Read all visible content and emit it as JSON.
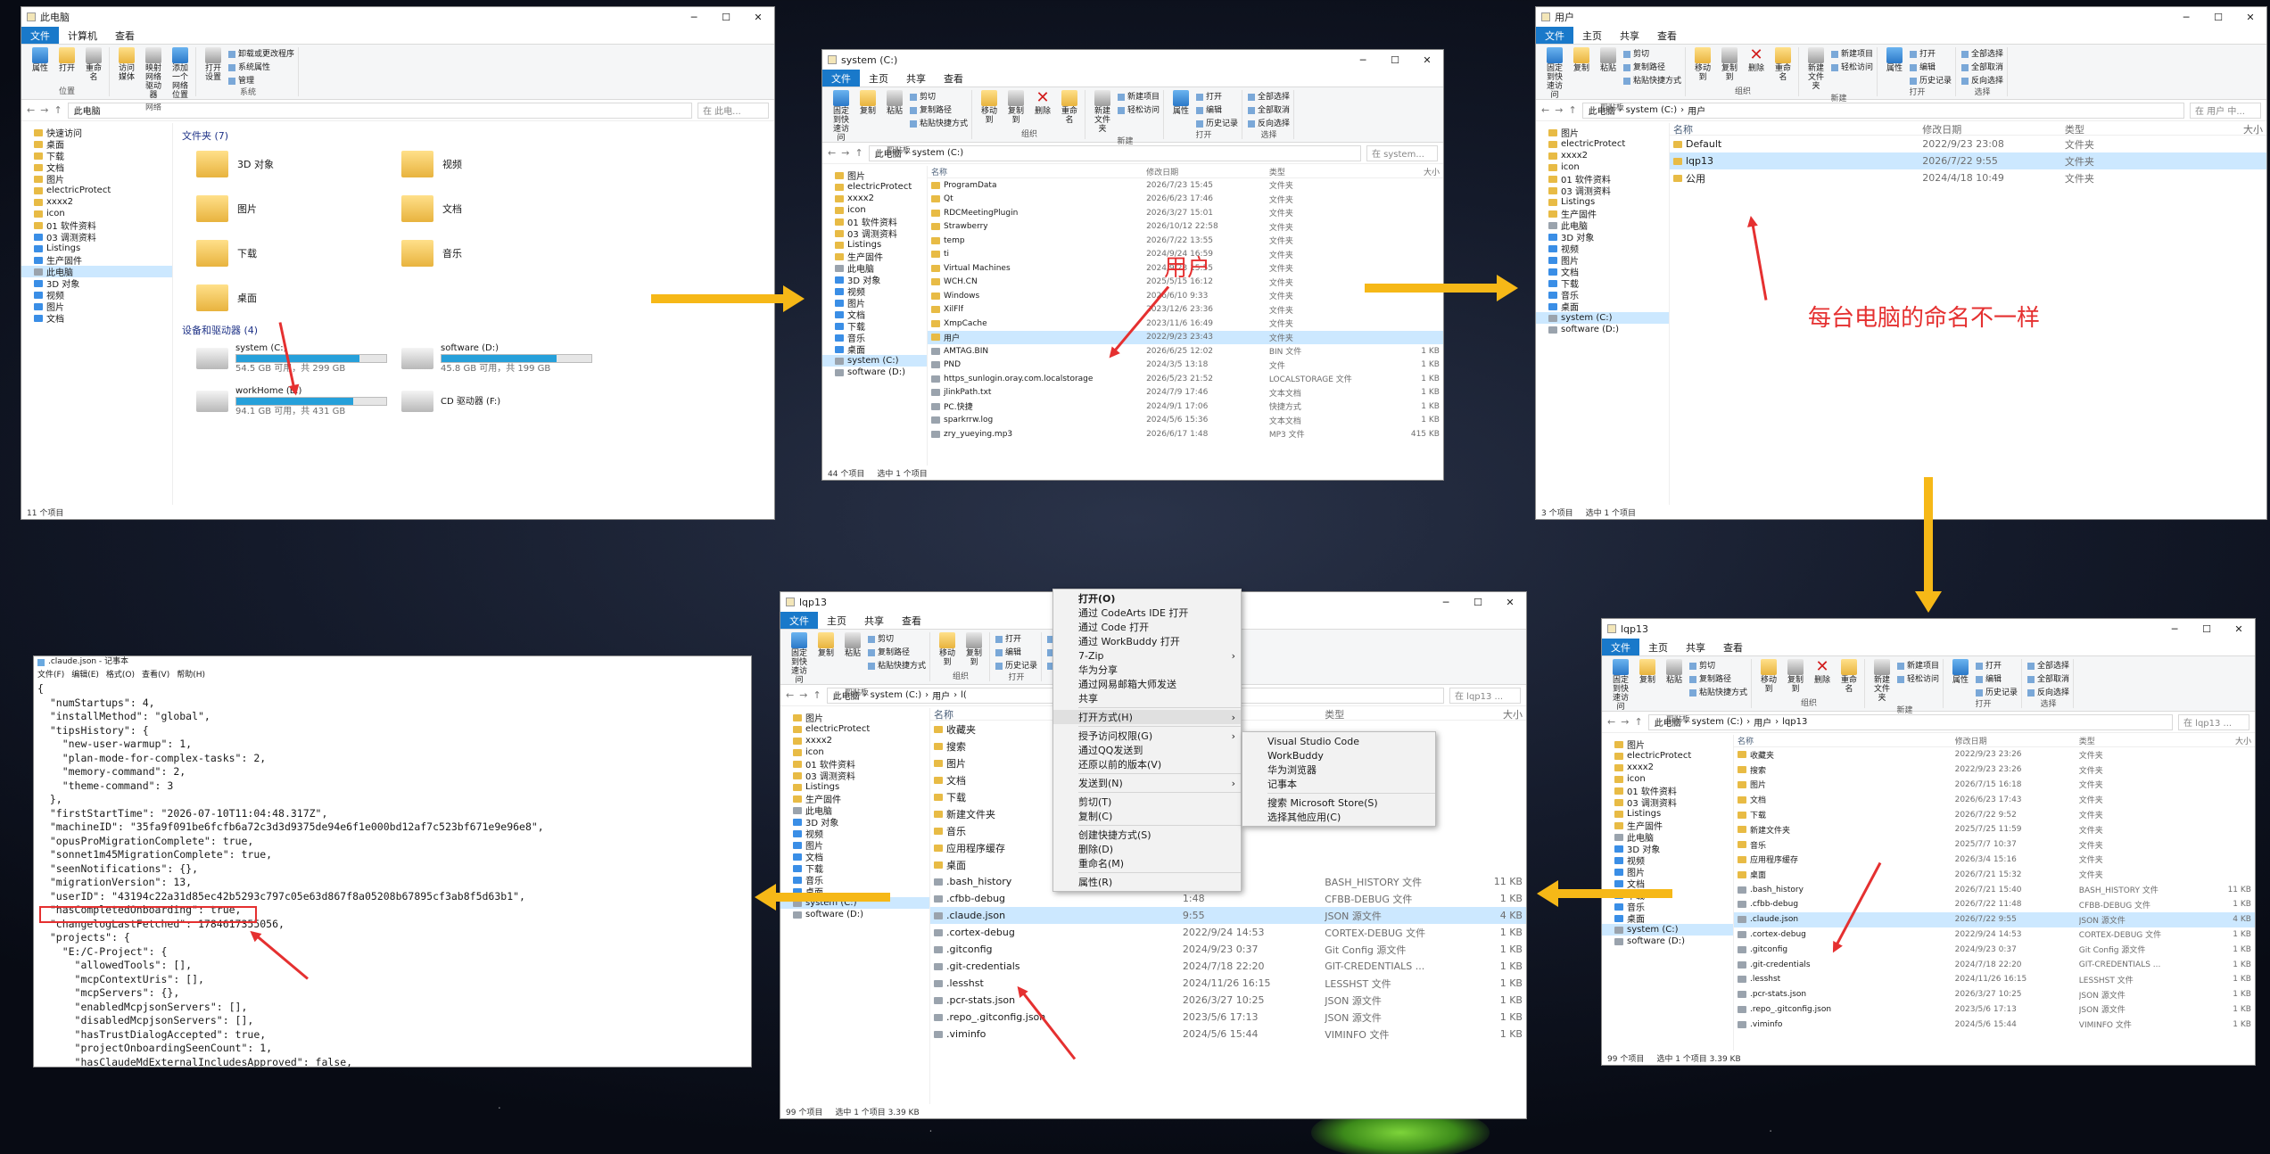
{
  "win1": {
    "title": "此电脑",
    "tabs": [
      "文件",
      "计算机",
      "查看"
    ],
    "ribbon": {
      "groups": [
        {
          "label": "位置",
          "buttons": [
            "属性",
            "打开",
            "重命名"
          ]
        },
        {
          "label": "网络",
          "buttons": [
            "访问媒体",
            "映射网络驱动器",
            "添加一个网络位置"
          ]
        },
        {
          "label": "系统",
          "buttons": [
            "打开设置"
          ],
          "small": [
            "卸载或更改程序",
            "系统属性",
            "管理"
          ]
        }
      ]
    },
    "path": "此电脑",
    "search": "在 此电...",
    "nav": [
      {
        "label": "快速访问"
      },
      {
        "label": "桌面"
      },
      {
        "label": "下载"
      },
      {
        "label": "文档"
      },
      {
        "label": "图片"
      },
      {
        "label": "electricProtect"
      },
      {
        "label": "xxxx2"
      },
      {
        "label": "icon"
      },
      {
        "label": "01 软件资料"
      },
      {
        "label": "03 调测资料"
      },
      {
        "label": "Listings"
      },
      {
        "label": "生产固件"
      },
      {
        "label": "此电脑",
        "sel": true
      },
      {
        "label": "3D 对象"
      },
      {
        "label": "视频"
      },
      {
        "label": "图片"
      },
      {
        "label": "文档"
      }
    ],
    "folders_header": "文件夹 (7)",
    "folders": [
      "3D 对象",
      "视频",
      "图片",
      "文档",
      "下载",
      "音乐",
      "桌面"
    ],
    "drives_header": "设备和驱动器 (4)",
    "drives": [
      {
        "name": "system (C:)",
        "free": "54.5 GB 可用，共 299 GB",
        "fill": 0.82
      },
      {
        "name": "software (D:)",
        "free": "45.8 GB 可用，共 199 GB",
        "fill": 0.77
      },
      {
        "name": "workHome (E:)",
        "free": "94.1 GB 可用，共 431 GB",
        "fill": 0.78
      },
      {
        "name": "CD 驱动器 (F:)",
        "free": "",
        "fill": 0
      }
    ],
    "status": "11 个项目"
  },
  "win2": {
    "title": "system (C:)",
    "tabs": [
      "文件",
      "主页",
      "共享",
      "查看"
    ],
    "ribbon": {
      "groups": [
        {
          "label": "剪贴板",
          "buttons": [
            "固定到快速访问",
            "复制",
            "粘贴"
          ],
          "small": [
            "剪切",
            "复制路径",
            "粘贴快捷方式"
          ]
        },
        {
          "label": "组织",
          "buttons": [
            "移动到",
            "复制到",
            "删除",
            "重命名"
          ]
        },
        {
          "label": "新建",
          "buttons": [
            "新建文件夹"
          ],
          "small": [
            "新建项目",
            "轻松访问"
          ]
        },
        {
          "label": "打开",
          "buttons": [
            "属性"
          ],
          "small": [
            "打开",
            "编辑",
            "历史记录"
          ]
        },
        {
          "label": "选择",
          "small": [
            "全部选择",
            "全部取消",
            "反向选择"
          ]
        }
      ]
    },
    "path": [
      "此电脑",
      "system (C:)"
    ],
    "search": "在 system...",
    "nav": [
      {
        "label": "图片"
      },
      {
        "label": "electricProtect"
      },
      {
        "label": "xxxx2"
      },
      {
        "label": "icon"
      },
      {
        "label": "01 软件资料"
      },
      {
        "label": "03 调测资料"
      },
      {
        "label": "Listings"
      },
      {
        "label": "生产固件"
      },
      {
        "label": "此电脑"
      },
      {
        "label": "3D 对象"
      },
      {
        "label": "视频"
      },
      {
        "label": "图片"
      },
      {
        "label": "文档"
      },
      {
        "label": "下载"
      },
      {
        "label": "音乐"
      },
      {
        "label": "桌面"
      },
      {
        "label": "system (C:)",
        "sel": true
      },
      {
        "label": "software (D:)"
      }
    ],
    "cols": [
      "名称",
      "修改日期",
      "类型",
      "大小"
    ],
    "files": [
      [
        "ProgramData",
        "2026/7/23 15:45",
        "文件夹",
        ""
      ],
      [
        "Qt",
        "2026/6/23 17:46",
        "文件夹",
        ""
      ],
      [
        "RDCMeetingPlugin",
        "2026/3/27 15:01",
        "文件夹",
        ""
      ],
      [
        "Strawberry",
        "2026/10/12 22:58",
        "文件夹",
        ""
      ],
      [
        "temp",
        "2026/7/22 13:55",
        "文件夹",
        ""
      ],
      [
        "ti",
        "2024/9/24 16:59",
        "文件夹",
        ""
      ],
      [
        "Virtual Machines",
        "2024/9/23 15:55",
        "文件夹",
        ""
      ],
      [
        "WCH.CN",
        "2025/5/15 16:12",
        "文件夹",
        ""
      ],
      [
        "Windows",
        "2026/6/10 9:33",
        "文件夹",
        ""
      ],
      [
        "XilFlf",
        "2023/12/6 23:36",
        "文件夹",
        ""
      ],
      [
        "XmpCache",
        "2023/11/6 16:49",
        "文件夹",
        ""
      ],
      [
        "用户",
        "2022/9/23 23:43",
        "文件夹",
        "",
        true
      ],
      [
        "AMTAG.BIN",
        "2026/6/25 12:02",
        "BIN 文件",
        "1 KB"
      ],
      [
        "PND",
        "2024/3/5 13:18",
        "文件",
        "1 KB"
      ],
      [
        "https_sunlogin.oray.com.localstorage",
        "2026/5/23 21:52",
        "LOCALSTORAGE 文件",
        "1 KB"
      ],
      [
        "jlinkPath.txt",
        "2024/7/9 17:46",
        "文本文档",
        "1 KB"
      ],
      [
        "PC.快捷",
        "2024/9/1 17:06",
        "快捷方式",
        "1 KB"
      ],
      [
        "sparkrrw.log",
        "2024/5/6 15:36",
        "文本文档",
        "1 KB"
      ],
      [
        "zry_yueying.mp3",
        "2026/6/17 1:48",
        "MP3 文件",
        "415 KB"
      ]
    ],
    "status": [
      "44 个项目",
      "选中 1 个项目"
    ]
  },
  "win3": {
    "title": "用户",
    "tabs": [
      "文件",
      "主页",
      "共享",
      "查看"
    ],
    "ribbon": {
      "groups": [
        {
          "label": "剪贴板",
          "buttons": [
            "固定到快速访问",
            "复制",
            "粘贴"
          ],
          "small": [
            "剪切",
            "复制路径",
            "粘贴快捷方式"
          ]
        },
        {
          "label": "组织",
          "buttons": [
            "移动到",
            "复制到",
            "删除",
            "重命名"
          ]
        },
        {
          "label": "新建",
          "buttons": [
            "新建文件夹"
          ],
          "small": [
            "新建项目",
            "轻松访问"
          ]
        },
        {
          "label": "打开",
          "buttons": [
            "属性"
          ],
          "small": [
            "打开",
            "编辑",
            "历史记录"
          ]
        },
        {
          "label": "选择",
          "small": [
            "全部选择",
            "全部取消",
            "反向选择"
          ]
        }
      ]
    },
    "path": [
      "此电脑",
      "system (C:)",
      "用户"
    ],
    "search": "在 用户 中...",
    "nav": [
      {
        "label": "图片"
      },
      {
        "label": "electricProtect"
      },
      {
        "label": "xxxx2"
      },
      {
        "label": "icon"
      },
      {
        "label": "01 软件资料"
      },
      {
        "label": "03 调测资料"
      },
      {
        "label": "Listings"
      },
      {
        "label": "生产固件"
      },
      {
        "label": "此电脑"
      },
      {
        "label": "3D 对象"
      },
      {
        "label": "视频"
      },
      {
        "label": "图片"
      },
      {
        "label": "文档"
      },
      {
        "label": "下载"
      },
      {
        "label": "音乐"
      },
      {
        "label": "桌面"
      },
      {
        "label": "system (C:)",
        "sel": true
      },
      {
        "label": "software (D:)"
      }
    ],
    "cols": [
      "名称",
      "修改日期",
      "类型",
      "大小"
    ],
    "files": [
      [
        "Default",
        "2022/9/23 23:08",
        "文件夹",
        ""
      ],
      [
        "lqp13",
        "2026/7/22 9:55",
        "文件夹",
        "",
        true
      ],
      [
        "公用",
        "2024/4/18 10:49",
        "文件夹",
        ""
      ]
    ],
    "status": [
      "3 个项目",
      "选中 1 个项目"
    ]
  },
  "win4": {
    "title": "lqp13",
    "tabs": [
      "文件",
      "主页",
      "共享",
      "查看"
    ],
    "ribbon": {
      "groups": [
        {
          "label": "剪贴板",
          "buttons": [
            "固定到快速访问",
            "复制",
            "粘贴"
          ],
          "small": [
            "剪切",
            "复制路径",
            "粘贴快捷方式"
          ]
        },
        {
          "label": "组织",
          "buttons": [
            "移动到",
            "复制到",
            "删除",
            "重命名"
          ]
        },
        {
          "label": "新建",
          "buttons": [
            "新建文件夹"
          ],
          "small": [
            "新建项目",
            "轻松访问"
          ]
        },
        {
          "label": "打开",
          "buttons": [
            "属性"
          ],
          "small": [
            "打开",
            "编辑",
            "历史记录"
          ]
        },
        {
          "label": "选择",
          "small": [
            "全部选择",
            "全部取消",
            "反向选择"
          ]
        }
      ]
    },
    "path": [
      "此电脑",
      "system (C:)",
      "用户",
      "lqp13"
    ],
    "search": "在 lqp13 ...",
    "nav": [
      {
        "label": "图片"
      },
      {
        "label": "electricProtect"
      },
      {
        "label": "xxxx2"
      },
      {
        "label": "icon"
      },
      {
        "label": "01 软件资料"
      },
      {
        "label": "03 调测资料"
      },
      {
        "label": "Listings"
      },
      {
        "label": "生产固件"
      },
      {
        "label": "此电脑"
      },
      {
        "label": "3D 对象"
      },
      {
        "label": "视频"
      },
      {
        "label": "图片"
      },
      {
        "label": "文档"
      },
      {
        "label": "下载"
      },
      {
        "label": "音乐"
      },
      {
        "label": "桌面"
      },
      {
        "label": "system (C:)",
        "sel": true
      },
      {
        "label": "software (D:)"
      }
    ],
    "cols": [
      "名称",
      "修改日期",
      "类型",
      "大小"
    ],
    "files": [
      [
        "收藏夹",
        "2022/9/23 23:26",
        "文件夹",
        ""
      ],
      [
        "搜索",
        "2022/9/23 23:26",
        "文件夹",
        ""
      ],
      [
        "图片",
        "2026/7/15 16:18",
        "文件夹",
        ""
      ],
      [
        "文档",
        "2026/6/23 17:43",
        "文件夹",
        ""
      ],
      [
        "下载",
        "2026/7/22 9:52",
        "文件夹",
        ""
      ],
      [
        "新建文件夹",
        "2025/7/25 11:59",
        "文件夹",
        ""
      ],
      [
        "音乐",
        "2025/7/7 10:37",
        "文件夹",
        ""
      ],
      [
        "应用程序缓存",
        "2026/3/4 15:16",
        "文件夹",
        ""
      ],
      [
        "桌面",
        "2026/7/21 15:32",
        "文件夹",
        ""
      ],
      [
        ".bash_history",
        "2026/7/21 15:40",
        "BASH_HISTORY 文件",
        "11 KB"
      ],
      [
        ".cfbb-debug",
        "2026/7/22 11:48",
        "CFBB-DEBUG 文件",
        "1 KB"
      ],
      [
        ".claude.json",
        "2026/7/22 9:55",
        "JSON 源文件",
        "4 KB",
        true
      ],
      [
        ".cortex-debug",
        "2022/9/24 14:53",
        "CORTEX-DEBUG 文件",
        "1 KB"
      ],
      [
        ".gitconfig",
        "2024/9/23 0:37",
        "Git Config 源文件",
        "1 KB"
      ],
      [
        ".git-credentials",
        "2024/7/18 22:20",
        "GIT-CREDENTIALS ...",
        "1 KB"
      ],
      [
        ".lesshst",
        "2024/11/26 16:15",
        "LESSHST 文件",
        "1 KB"
      ],
      [
        ".pcr-stats.json",
        "2026/3/27 10:25",
        "JSON 源文件",
        "1 KB"
      ],
      [
        ".repo_.gitconfig.json",
        "2023/5/6 17:13",
        "JSON 源文件",
        "1 KB"
      ],
      [
        ".viminfo",
        "2024/5/6 15:44",
        "VIMINFO 文件",
        "1 KB"
      ]
    ],
    "status": [
      "99 个项目",
      "选中 1 个项目 3.39 KB"
    ]
  },
  "win5": {
    "title": "lqp13",
    "tabs": [
      "文件",
      "主页",
      "共享",
      "查看"
    ],
    "ribbon": {
      "groups": [
        {
          "label": "剪贴板",
          "buttons": [
            "固定到快速访问",
            "复制",
            "粘贴"
          ],
          "small": [
            "剪切",
            "复制路径",
            "粘贴快捷方式"
          ]
        },
        {
          "label": "组织",
          "buttons": [
            "移动到",
            "复制到"
          ]
        },
        {
          "label": "打开",
          "small": [
            "打开",
            "编辑",
            "历史记录"
          ]
        },
        {
          "label": "选择",
          "small": [
            "全部选择",
            "全部取消",
            "反向选择"
          ]
        }
      ]
    },
    "path": [
      "此电脑",
      "system (C:)",
      "用户",
      "l("
    ],
    "search": "在 lqp13 ...",
    "nav": [
      {
        "label": "图片"
      },
      {
        "label": "electricProtect"
      },
      {
        "label": "xxxx2"
      },
      {
        "label": "icon"
      },
      {
        "label": "01 软件资料"
      },
      {
        "label": "03 调测资料"
      },
      {
        "label": "Listings"
      },
      {
        "label": "生产固件"
      },
      {
        "label": "此电脑"
      },
      {
        "label": "3D 对象"
      },
      {
        "label": "视频"
      },
      {
        "label": "图片"
      },
      {
        "label": "文档"
      },
      {
        "label": "下载"
      },
      {
        "label": "音乐"
      },
      {
        "label": "桌面"
      },
      {
        "label": "system (C:)",
        "sel": true
      },
      {
        "label": "software (D:)"
      }
    ],
    "cols": [
      "名称",
      "修改日期",
      "类型",
      "大小"
    ],
    "files": [
      [
        "收藏夹",
        "",
        "",
        ""
      ],
      [
        "搜索",
        "",
        "",
        ""
      ],
      [
        "图片",
        "",
        "",
        ""
      ],
      [
        "文档",
        "",
        "",
        ""
      ],
      [
        "下载",
        "",
        "",
        ""
      ],
      [
        "新建文件夹",
        "",
        "",
        ""
      ],
      [
        "音乐",
        "",
        "",
        ""
      ],
      [
        "应用程序缓存",
        "",
        "",
        ""
      ],
      [
        "桌面",
        "",
        "",
        ""
      ],
      [
        ".bash_history",
        "5:40",
        "BASH_HISTORY 文件",
        "11 KB"
      ],
      [
        ".cfbb-debug",
        "1:48",
        "CFBB-DEBUG 文件",
        "1 KB"
      ],
      [
        ".claude.json",
        "9:55",
        "JSON 源文件",
        "4 KB",
        true
      ],
      [
        ".cortex-debug",
        "2022/9/24 14:53",
        "CORTEX-DEBUG 文件",
        "1 KB"
      ],
      [
        ".gitconfig",
        "2024/9/23 0:37",
        "Git Config 源文件",
        "1 KB"
      ],
      [
        ".git-credentials",
        "2024/7/18 22:20",
        "GIT-CREDENTIALS ...",
        "1 KB"
      ],
      [
        ".lesshst",
        "2024/11/26 16:15",
        "LESSHST 文件",
        "1 KB"
      ],
      [
        ".pcr-stats.json",
        "2026/3/27 10:25",
        "JSON 源文件",
        "1 KB"
      ],
      [
        ".repo_.gitconfig.json",
        "2023/5/6 17:13",
        "JSON 源文件",
        "1 KB"
      ],
      [
        ".viminfo",
        "2024/5/6 15:44",
        "VIMINFO 文件",
        "1 KB"
      ]
    ],
    "status": [
      "99 个项目",
      "选中 1 个项目 3.39 KB"
    ],
    "context_menu": [
      {
        "label": "打开(O)",
        "bold": true
      },
      {
        "label": "通过 CodeArts IDE 打开"
      },
      {
        "label": "通过 Code 打开"
      },
      {
        "label": "通过 WorkBuddy 打开"
      },
      {
        "label": "7-Zip",
        "sub": true
      },
      {
        "label": "华为分享"
      },
      {
        "label": "通过网易邮箱大师发送"
      },
      {
        "label": "共享"
      },
      {
        "sep": true
      },
      {
        "label": "打开方式(H)",
        "sub": true,
        "hl": true
      },
      {
        "sep": true
      },
      {
        "label": "授予访问权限(G)",
        "sub": true
      },
      {
        "label": "通过QQ发送到"
      },
      {
        "label": "还原以前的版本(V)"
      },
      {
        "sep": true
      },
      {
        "label": "发送到(N)",
        "sub": true
      },
      {
        "sep": true
      },
      {
        "label": "剪切(T)"
      },
      {
        "label": "复制(C)"
      },
      {
        "sep": true
      },
      {
        "label": "创建快捷方式(S)"
      },
      {
        "label": "删除(D)"
      },
      {
        "label": "重命名(M)"
      },
      {
        "sep": true
      },
      {
        "label": "属性(R)"
      }
    ],
    "open_with": [
      {
        "label": "Visual Studio Code"
      },
      {
        "label": "WorkBuddy"
      },
      {
        "label": "华为浏览器"
      },
      {
        "label": "记事本"
      },
      {
        "sep": true
      },
      {
        "label": "搜索 Microsoft Store(S)"
      },
      {
        "label": "选择其他应用(C)"
      }
    ]
  },
  "notepad": {
    "title": ".claude.json - 记事本",
    "menu": [
      "文件(F)",
      "编辑(E)",
      "格式(O)",
      "查看(V)",
      "帮助(H)"
    ],
    "lines": [
      "{",
      "  \"numStartups\": 4,",
      "  \"installMethod\": \"global\",",
      "  \"tipsHistory\": {",
      "    \"new-user-warmup\": 1,",
      "    \"plan-mode-for-complex-tasks\": 2,",
      "    \"memory-command\": 2,",
      "    \"theme-command\": 3",
      "  },",
      "  \"firstStartTime\": \"2026-07-10T11:04:48.317Z\",",
      "  \"machineID\": \"35fa9f091be6fcfb6a72c3d3d9375de94e6f1e000bd12af7c523bf671e9e96e8\",",
      "  \"opusProMigrationComplete\": true,",
      "  \"sonnet1m45MigrationComplete\": true,",
      "  \"seenNotifications\": {},",
      "  \"migrationVersion\": 13,",
      "  \"userID\": \"43194c22a31d85ec42b5293c797c05e63d867f8a05208b67895cf3ab8f5d63b1\",",
      "  \"hasCompletedOnboarding\": true,",
      "  \"changelogLastFetched\": 1784617355056,",
      "  \"projects\": {",
      "    \"E:/C-Project\": {",
      "      \"allowedTools\": [],",
      "      \"mcpContextUris\": [],",
      "      \"mcpServers\": {},",
      "      \"enabledMcpjsonServers\": [],",
      "      \"disabledMcpjsonServers\": [],",
      "      \"hasTrustDialogAccepted\": true,",
      "      \"projectOnboardingSeenCount\": 1,",
      "      \"hasClaudeMdExternalIncludesApproved\": false,"
    ],
    "highlight_line": 16
  },
  "annotations": {
    "users_label": "用户",
    "naming_note": "每台电脑的命名不一样"
  },
  "colors": {
    "accent": "#1979ca",
    "arrow": "#f6b817",
    "annotation": "#e53030",
    "selection": "#cce8ff"
  }
}
